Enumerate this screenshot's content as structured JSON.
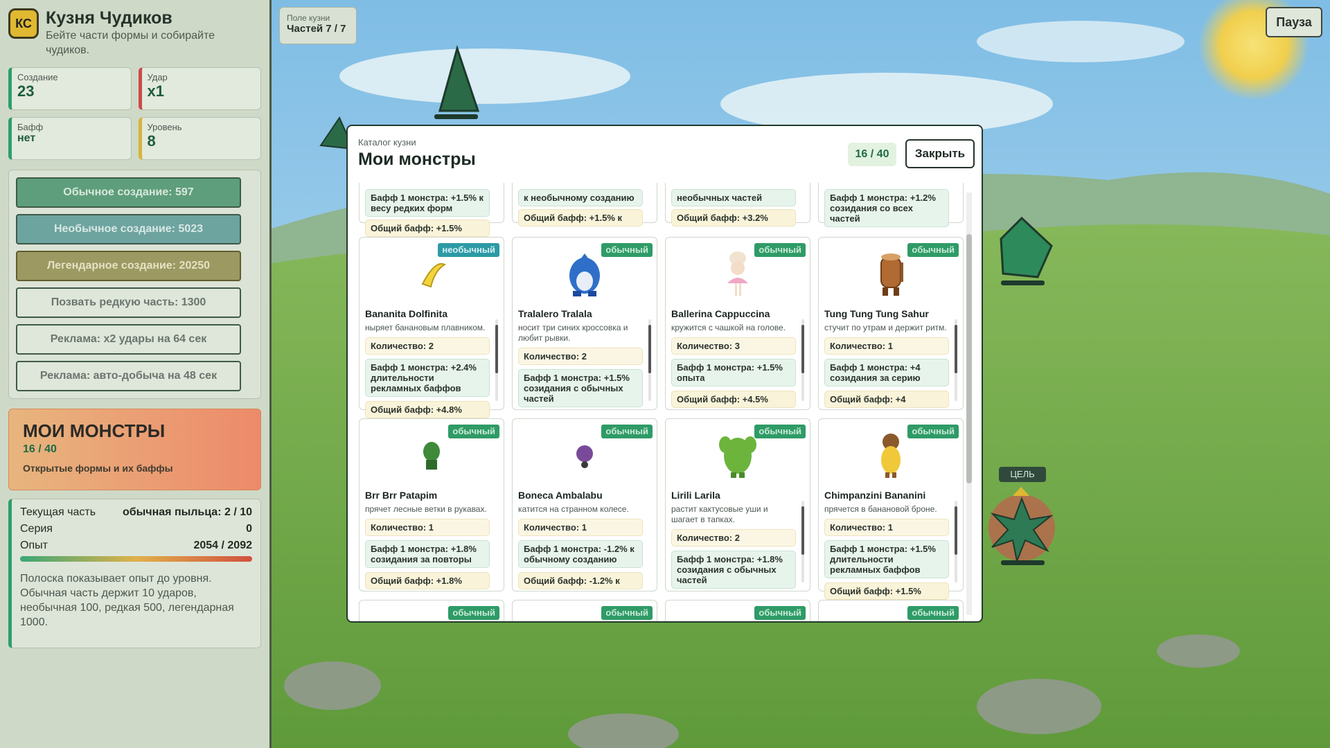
{
  "sidebar": {
    "logo": "КС",
    "title": "Кузня Чудиков",
    "subtitle": "Бейте части формы и собирайте чудиков.",
    "stats": {
      "creation_label": "Создание",
      "creation_value": "23",
      "hit_label": "Удар",
      "hit_value": "x1",
      "buff_label": "Бафф",
      "buff_value": "нет",
      "level_label": "Уровень",
      "level_value": "8"
    },
    "actions": [
      "Обычное создание: 597",
      "Необычное создание: 5023",
      "Легендарное создание: 20250",
      "Позвать редкую часть: 1300",
      "Реклама: x2 удары на 64 сек",
      "Реклама: авто-добыча на 48 сек"
    ],
    "monsters": {
      "title": "МОИ МОНСТРЫ",
      "count": "16 / 40",
      "subtitle": "Открытые формы и их баффы"
    },
    "progress": {
      "current_label": "Текущая часть",
      "current_value": "обычная пыльца: 2 / 10",
      "streak_label": "Серия",
      "streak_value": "0",
      "xp_label": "Опыт",
      "xp_value": "2054 / 2092",
      "xp_fraction": 0.98,
      "note": "Полоска показывает опыт до уровня. Обычная часть держит 10 ударов, необычная 100, редкая 500, легендарная 1000."
    }
  },
  "hud": {
    "parts_label": "Поле кузни",
    "parts_value": "Частей 7 / 7",
    "pause": "Пауза",
    "target": "ЦЕЛЬ"
  },
  "modal": {
    "category": "Каталог кузни",
    "title": "Мои монстры",
    "count": "16 / 40",
    "close": "Закрыть",
    "top_fragments": [
      {
        "buff": "Бафф 1 монстра: +1.5% к весу редких форм",
        "total": "Общий бафф: +1.5%"
      },
      {
        "buff": "к необычному созданию",
        "total": "Общий бафф: +1.5% к"
      },
      {
        "buff": "необычных частей",
        "total": "Общий бафф: +3.2%"
      },
      {
        "buff": "Бафф 1 монстра: +1.2% созидания со всех частей",
        "total": ""
      }
    ],
    "cards": [
      {
        "rarity": "необычный",
        "name": "Bananita Dolfinita",
        "desc": "ныряет банановым плавником.",
        "qty": "Количество: 2",
        "buff": "Бафф 1 монстра: +2.4% длительности рекламных баффов",
        "total": "Общий бафф: +4.8%"
      },
      {
        "rarity": "обычный",
        "name": "Tralalero Tralala",
        "desc": "носит три синих кроссовка и любит рывки.",
        "qty": "Количество: 2",
        "buff": "Бафф 1 монстра: +1.5% созидания с обычных частей",
        "total": ""
      },
      {
        "rarity": "обычный",
        "name": "Ballerina Cappuccina",
        "desc": "кружится с чашкой на голове.",
        "qty": "Количество: 3",
        "buff": "Бафф 1 монстра: +1.5% опыта",
        "total": "Общий бафф: +4.5%"
      },
      {
        "rarity": "обычный",
        "name": "Tung Tung Tung Sahur",
        "desc": "стучит по утрам и держит ритм.",
        "qty": "Количество: 1",
        "buff": "Бафф 1 монстра: +4 созидания за серию",
        "total": "Общий бафф: +4"
      },
      {
        "rarity": "обычный",
        "name": "Brr Brr Patapim",
        "desc": "прячет лесные ветки в рукавах.",
        "qty": "Количество: 1",
        "buff": "Бафф 1 монстра: +1.8% созидания за повторы",
        "total": "Общий бафф: +1.8%"
      },
      {
        "rarity": "обычный",
        "name": "Boneca Ambalabu",
        "desc": "катится на странном колесе.",
        "qty": "Количество: 1",
        "buff": "Бафф 1 монстра: -1.2% к обычному созданию",
        "total": "Общий бафф: -1.2% к"
      },
      {
        "rarity": "обычный",
        "name": "Lirili Larila",
        "desc": "растит кактусовые уши и шагает в тапках.",
        "qty": "Количество: 2",
        "buff": "Бафф 1 монстра: +1.8% созидания с обычных частей",
        "total": ""
      },
      {
        "rarity": "обычный",
        "name": "Chimpanzini Bananini",
        "desc": "прячется в банановой броне.",
        "qty": "Количество: 1",
        "buff": "Бафф 1 монстра: +1.5% длительности рекламных баффов",
        "total": "Общий бафф: +1.5%"
      }
    ],
    "bottom_badges": [
      "обычный",
      "обычный",
      "обычный",
      "обычный"
    ]
  },
  "colors": {
    "accent": "#2f9b67",
    "uncommon": "#2c9aa5",
    "sky": "#9fd0ee",
    "grass": "#6fa446"
  }
}
